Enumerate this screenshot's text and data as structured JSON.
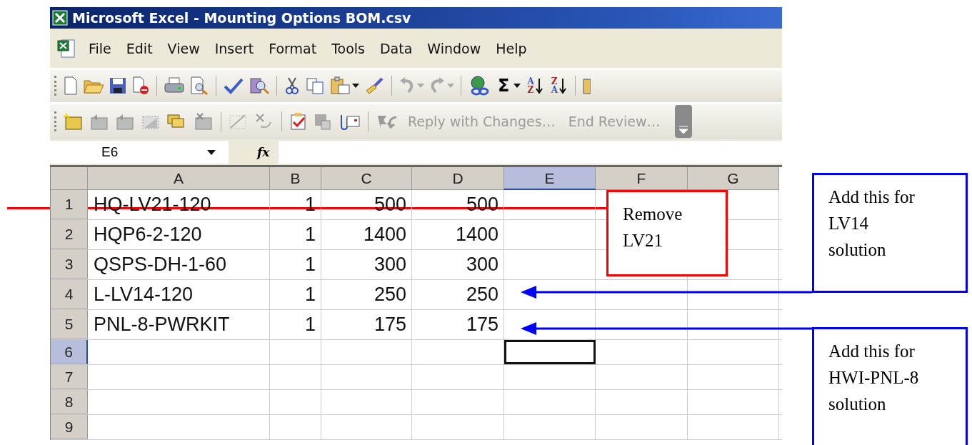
{
  "window": {
    "title": "Microsoft Excel - Mounting Options BOM.csv"
  },
  "menu": [
    "File",
    "Edit",
    "View",
    "Insert",
    "Format",
    "Tools",
    "Data",
    "Window",
    "Help"
  ],
  "toolbar": {
    "sum_symbol": "Σ",
    "sort_ascending": [
      "A",
      "Z"
    ],
    "sort_descending": [
      "Z",
      "A"
    ]
  },
  "review_toolbar": {
    "buttons": [
      {
        "label": "Reply with Changes…",
        "disabled": true
      },
      {
        "label": "End Review…",
        "disabled": true
      }
    ]
  },
  "formula_bar": {
    "name_box": "E6",
    "fx": "fx"
  },
  "sheet": {
    "columns": [
      {
        "label": "A",
        "selected": false
      },
      {
        "label": "B",
        "selected": false
      },
      {
        "label": "C",
        "selected": false
      },
      {
        "label": "D",
        "selected": false
      },
      {
        "label": "E",
        "selected": true
      },
      {
        "label": "F",
        "selected": false
      },
      {
        "label": "G",
        "selected": false
      }
    ],
    "rows": [
      {
        "number": "1",
        "selected": false,
        "cells": [
          "HQ-LV21-120",
          "1",
          "500",
          "500"
        ]
      },
      {
        "number": "2",
        "selected": false,
        "cells": [
          "HQP6-2-120",
          "1",
          "1400",
          "1400"
        ]
      },
      {
        "number": "3",
        "selected": false,
        "cells": [
          "QSPS-DH-1-60",
          "1",
          "300",
          "300"
        ]
      },
      {
        "number": "4",
        "selected": false,
        "cells": [
          "L-LV14-120",
          "1",
          "250",
          "250"
        ]
      },
      {
        "number": "5",
        "selected": false,
        "cells": [
          "PNL-8-PWRKIT",
          "1",
          "175",
          "175"
        ]
      },
      {
        "number": "6",
        "selected": true
      },
      {
        "number": "7",
        "selected": false
      },
      {
        "number": "8",
        "selected": false
      },
      {
        "number": "9",
        "selected": false
      }
    ]
  },
  "annotations": [
    {
      "kind": "strike-line",
      "color": "#ff0000"
    },
    {
      "kind": "note",
      "color": "#ff0000",
      "lines": [
        "Remove",
        "LV21"
      ]
    },
    {
      "kind": "note",
      "color": "#0000ff",
      "lines": [
        "Add this for",
        "LV14",
        "solution"
      ]
    },
    {
      "kind": "arrow",
      "color": "#0000ff"
    },
    {
      "kind": "arrow",
      "color": "#0000ff"
    },
    {
      "kind": "note",
      "color": "#0000ff",
      "lines": [
        "Add this for",
        "HWI-PNL-8",
        "solution"
      ]
    }
  ]
}
